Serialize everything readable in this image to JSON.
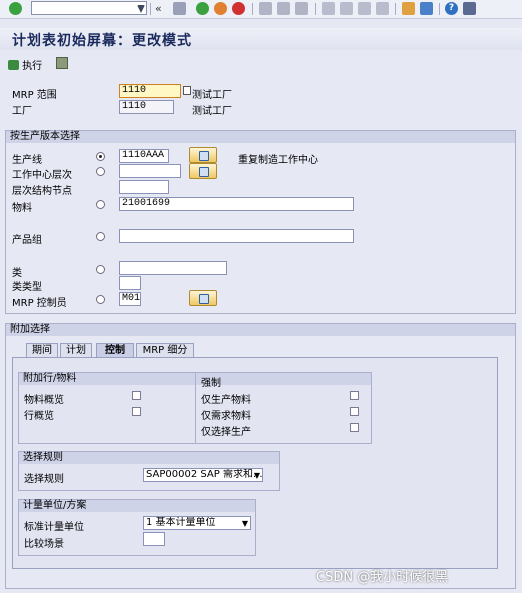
{
  "title": "计划表初始屏幕：更改模式",
  "execute_label": "执行",
  "header": {
    "mrp_area_label": "MRP 范围",
    "mrp_area_value": "1110",
    "mrp_area_desc": "测试工厂",
    "plant_label": "工厂",
    "plant_value": "1110",
    "plant_desc": "测试工厂"
  },
  "version_select": {
    "title": "按生产版本选择",
    "line_label": "生产线",
    "line_value": "1110AAA",
    "line_desc": "重复制造工作中心",
    "wc_hier_label": "工作中心层次",
    "hier_node_label": "层次结构节点",
    "material_label": "物料",
    "material_value": "21001699",
    "product_group_label": "产品组",
    "class_label": "类",
    "class_type_label": "类类型",
    "mrp_controller_label": "MRP 控制员",
    "mrp_controller_value": "M01"
  },
  "extra": {
    "title": "附加选择",
    "tabs": [
      "期间",
      "计划",
      "控制",
      "MRP 细分"
    ],
    "add_rows_title": "附加行/物料",
    "material_overview": "物料概览",
    "row_overview": "行概览",
    "force_title": "强制",
    "only_prod_material": "仅生产物料",
    "only_req_material": "仅需求物料",
    "only_sel_prod": "仅选择生产",
    "rule_title": "选择规则",
    "rule_label": "选择规则",
    "rule_value": "SAP00002 SAP 需求和...",
    "uom_title": "计量单位/方案",
    "std_uom_label": "标准计量单位",
    "std_uom_value": "1 基本计量单位",
    "compare_label": "比较场景"
  },
  "watermark": "CSDN @我小时候很黑",
  "colors": {
    "accent": "#1a2a5c",
    "required": "#fff8c4"
  }
}
